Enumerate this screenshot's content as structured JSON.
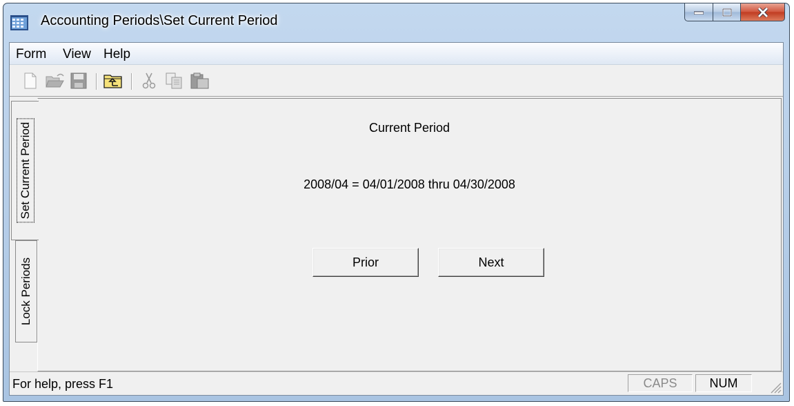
{
  "window": {
    "title": "Accounting Periods\\Set Current Period",
    "icon": "app-grid-icon"
  },
  "caption_buttons": {
    "minimize": "minimize-icon",
    "maximize": "maximize-icon",
    "close": "close-icon"
  },
  "menu": {
    "items": [
      "Form",
      "View",
      "Help"
    ]
  },
  "toolbar": {
    "icons": [
      "new-icon",
      "open-icon",
      "save-icon",
      "up-folder-icon",
      "cut-icon",
      "copy-icon",
      "paste-icon"
    ]
  },
  "tabs": [
    {
      "label": "Set Current Period",
      "selected": true
    },
    {
      "label": "Lock Periods",
      "selected": false
    }
  ],
  "panel": {
    "current_label": "Current Period",
    "current_value": "2008/04 = 04/01/2008 thru 04/30/2008",
    "prior_label": "Prior",
    "next_label": "Next"
  },
  "status": {
    "text": "For help, press F1",
    "caps": "CAPS",
    "num": "NUM",
    "caps_active": false,
    "num_active": true
  },
  "colors": {
    "titlebar": "#b9d1ea",
    "close_button": "#c9452a",
    "face": "#f0f0f0"
  }
}
